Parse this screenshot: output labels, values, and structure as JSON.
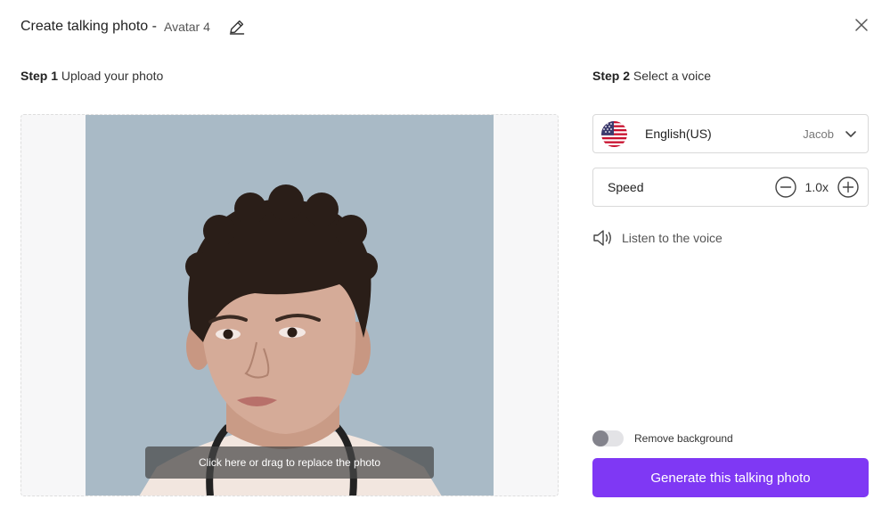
{
  "header": {
    "title": "Create talking photo -",
    "avatar_name": "Avatar 4"
  },
  "icons": {
    "edit": "edit-pencil-icon",
    "close": "close-icon",
    "flag": "us-flag-icon",
    "chevron": "chevron-down-icon",
    "minus": "minus-circle-icon",
    "plus": "plus-circle-icon",
    "speaker": "speaker-icon"
  },
  "step1": {
    "number": "Step 1",
    "label": "Upload your photo",
    "replace_hint": "Click here or drag to replace the photo"
  },
  "step2": {
    "number": "Step 2",
    "label": "Select a voice",
    "language": "English(US)",
    "voice": "Jacob",
    "speed_label": "Speed",
    "speed_value": "1.0x",
    "listen_label": "Listen to the voice"
  },
  "options": {
    "remove_background_label": "Remove background",
    "remove_background_on": false
  },
  "actions": {
    "generate_label": "Generate this talking photo"
  },
  "colors": {
    "accent": "#7f38f4",
    "photo_background": "#a9bac6"
  }
}
